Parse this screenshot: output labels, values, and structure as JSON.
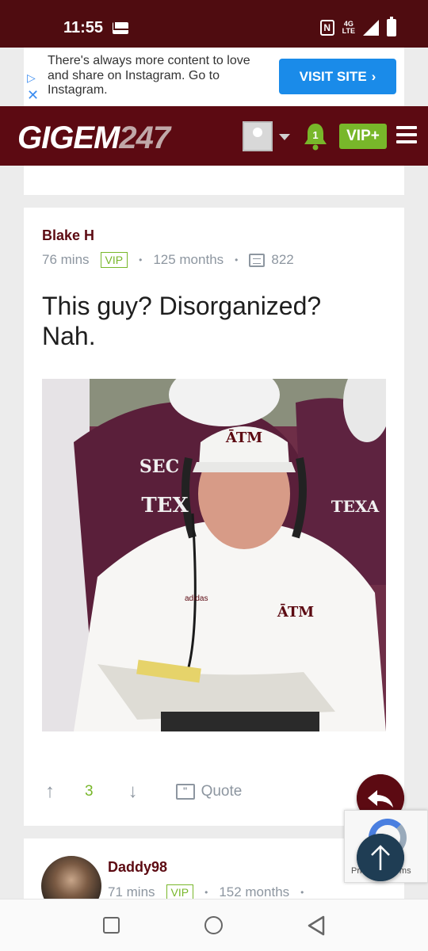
{
  "status_bar": {
    "time": "11:55",
    "network": "4G LTE",
    "icons": [
      "mail-icon",
      "nfc-icon",
      "signal-icon",
      "battery-charging-icon"
    ]
  },
  "ad": {
    "text": "There's always more content to love and share on Instagram. Go to Instagram.",
    "button_label": "VISIT SITE",
    "button_color": "#1a8be9"
  },
  "header": {
    "logo_main": "GIGEM",
    "logo_num": "247",
    "notification_count": "1",
    "vip_label": "VIP+",
    "brand_color": "#5c0a12",
    "accent_color": "#78b72a"
  },
  "posts": [
    {
      "author": "Blake H",
      "time_ago": "76 mins",
      "badge": "VIP",
      "tenure": "125 months",
      "post_count": "822",
      "text": "This guy? Disorganized? Nah.",
      "vote_count": "3",
      "quote_label": "Quote"
    },
    {
      "author": "Daddy98",
      "time_ago": "71 mins",
      "badge": "VIP",
      "tenure": "152 months"
    }
  ],
  "recaptcha": {
    "text": "Privacy - Terms"
  }
}
